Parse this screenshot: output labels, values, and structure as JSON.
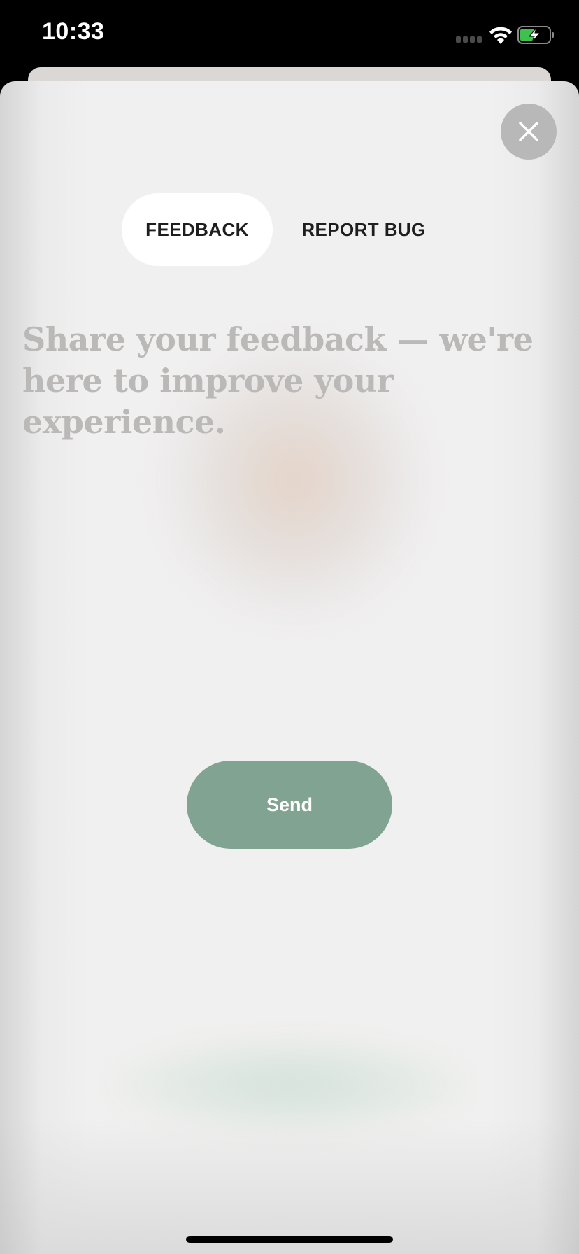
{
  "status_bar": {
    "time": "10:33",
    "icons": [
      "cellular-signal-icon",
      "wifi-icon",
      "battery-charging-icon"
    ],
    "battery_color": "#3fc14f"
  },
  "close_button": {
    "icon": "close-icon"
  },
  "tabs": [
    {
      "label": "FEEDBACK",
      "active": true
    },
    {
      "label": "REPORT BUG",
      "active": false
    }
  ],
  "feedback_input": {
    "placeholder": "Share your feedback — we're here to improve your experience."
  },
  "send_button": {
    "label": "Send",
    "color": "#81a391"
  }
}
